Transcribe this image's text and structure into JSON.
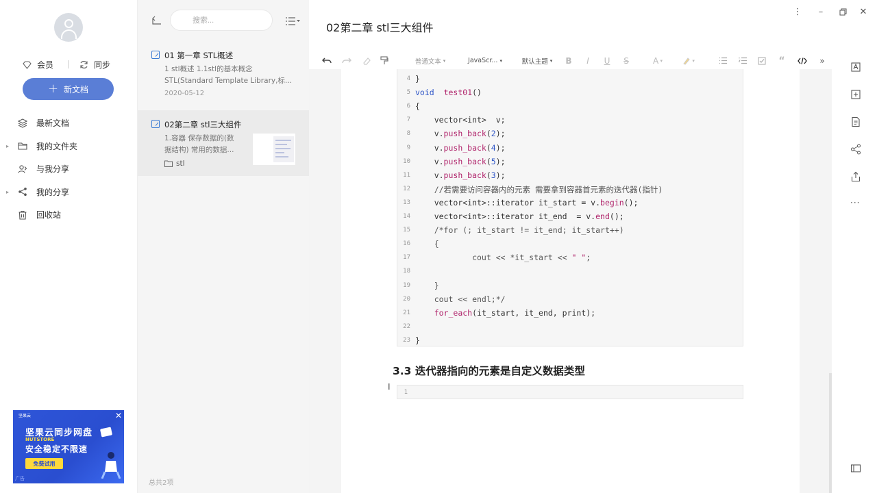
{
  "sidebar": {
    "member": "会员",
    "sync": "同步",
    "new_doc": "新文档",
    "nav": [
      {
        "label": "最新文档",
        "has_caret": false
      },
      {
        "label": "我的文件夹",
        "has_caret": true
      },
      {
        "label": "与我分享",
        "has_caret": false
      },
      {
        "label": "我的分享",
        "has_caret": true
      },
      {
        "label": "回收站",
        "has_caret": false
      }
    ],
    "ad": {
      "brand": "坚果云",
      "line1": "坚果云同步网盘",
      "line2": "NUTSTORE",
      "line3": "安全稳定不限速",
      "button": "免费试用",
      "tag": "广告"
    }
  },
  "list": {
    "search_placeholder": "搜索...",
    "notes": [
      {
        "title": "01 第一章 STL概述",
        "summary1": "1 stl概述 1.1stl的基本概念",
        "summary2": "STL(Standard Template Library,标...",
        "date": "2020-05-12"
      },
      {
        "title": "02第二章 stl三大组件",
        "summary1": "1.容器 保存数据的(数",
        "summary2": "据结构) 常用的数据...",
        "folder": "stl"
      }
    ],
    "count": "总共2项"
  },
  "doc": {
    "title": "02第二章 stl三大组件",
    "toolbar": {
      "paragraph": "普通文本",
      "language": "JavaScr...",
      "theme": "默认主题"
    },
    "code_lines": [
      {
        "n": "4",
        "segs": [
          [
            "}",
            ""
          ]
        ]
      },
      {
        "n": "5",
        "segs": [
          [
            "void",
            "kw"
          ],
          [
            "  ",
            ""
          ],
          [
            "test01",
            "fn"
          ],
          [
            "()",
            ""
          ]
        ]
      },
      {
        "n": "6",
        "segs": [
          [
            "{",
            ""
          ]
        ]
      },
      {
        "n": "7",
        "segs": [
          [
            "    vector<int>  v;",
            ""
          ]
        ]
      },
      {
        "n": "8",
        "segs": [
          [
            "    v.",
            ""
          ],
          [
            "push_back",
            "fn"
          ],
          [
            "(",
            ""
          ],
          [
            "2",
            "num"
          ],
          [
            ");",
            ""
          ]
        ]
      },
      {
        "n": "9",
        "segs": [
          [
            "    v.",
            ""
          ],
          [
            "push_back",
            "fn"
          ],
          [
            "(",
            ""
          ],
          [
            "4",
            "num"
          ],
          [
            ");",
            ""
          ]
        ]
      },
      {
        "n": "10",
        "segs": [
          [
            "    v.",
            ""
          ],
          [
            "push_back",
            "fn"
          ],
          [
            "(",
            ""
          ],
          [
            "5",
            "num"
          ],
          [
            ");",
            ""
          ]
        ]
      },
      {
        "n": "11",
        "segs": [
          [
            "    v.",
            ""
          ],
          [
            "push_back",
            "fn"
          ],
          [
            "(",
            ""
          ],
          [
            "3",
            "num"
          ],
          [
            ");",
            ""
          ]
        ]
      },
      {
        "n": "12",
        "segs": [
          [
            "    //若需要访问容器内的元素 需要拿到容器首元素的迭代器(指针)",
            "cm"
          ]
        ]
      },
      {
        "n": "13",
        "segs": [
          [
            "    vector<int>::iterator it_start = v.",
            ""
          ],
          [
            "begin",
            "fn"
          ],
          [
            "();",
            ""
          ]
        ]
      },
      {
        "n": "14",
        "segs": [
          [
            "    vector<int>::iterator it_end  = v.",
            ""
          ],
          [
            "end",
            "fn"
          ],
          [
            "();",
            ""
          ]
        ]
      },
      {
        "n": "15",
        "segs": [
          [
            "    /*for (; it_start != it_end; it_start++)",
            "cm"
          ]
        ]
      },
      {
        "n": "16",
        "segs": [
          [
            "    {",
            "cm"
          ]
        ]
      },
      {
        "n": "17",
        "segs": [
          [
            "            cout << *it_start << ",
            "cm"
          ],
          [
            "\" \"",
            "fn"
          ],
          [
            ";",
            "cm"
          ]
        ]
      },
      {
        "n": "18",
        "segs": [
          [
            "",
            ""
          ]
        ]
      },
      {
        "n": "19",
        "segs": [
          [
            "    }",
            "cm"
          ]
        ]
      },
      {
        "n": "20",
        "segs": [
          [
            "    cout << endl;*/",
            "cm"
          ]
        ]
      },
      {
        "n": "21",
        "segs": [
          [
            "    ",
            ""
          ],
          [
            "for_each",
            "fn"
          ],
          [
            "(it_start, it_end, print);",
            ""
          ]
        ]
      },
      {
        "n": "22",
        "segs": [
          [
            "",
            ""
          ]
        ]
      },
      {
        "n": "23",
        "segs": [
          [
            "}",
            ""
          ]
        ]
      }
    ],
    "section": "3.3 迭代器指向的元素是自定义数据类型",
    "code2_line": "1"
  },
  "colors": {
    "accent": "#5a7ed6",
    "keyword": "#2f56c7",
    "function": "#b0246b"
  }
}
